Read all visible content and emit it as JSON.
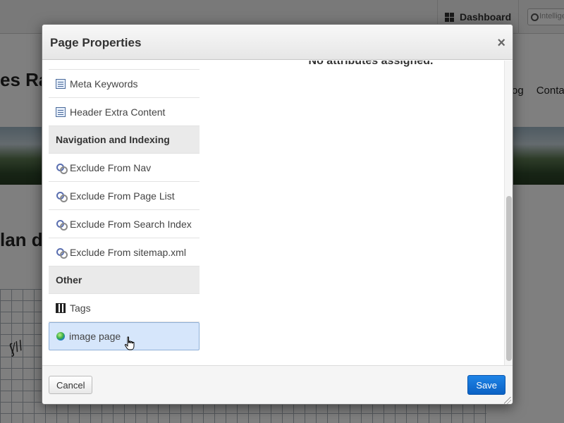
{
  "background": {
    "toolbar": {
      "dashboard_label": "Dashboard",
      "search_placeholder": "Intelligent"
    },
    "site_title": "es Ra",
    "nav": [
      "og",
      "Conta"
    ],
    "heading": "lan d"
  },
  "dialog": {
    "title": "Page Properties",
    "close_glyph": "×",
    "attribute_groups": [
      {
        "type": "item",
        "icon": "textarea-icon",
        "label": "Meta Keywords"
      },
      {
        "type": "item",
        "icon": "textarea-icon",
        "label": "Header Extra Content"
      },
      {
        "type": "category",
        "label": "Navigation and Indexing"
      },
      {
        "type": "item",
        "icon": "boolean-icon",
        "label": "Exclude From Nav"
      },
      {
        "type": "item",
        "icon": "boolean-icon",
        "label": "Exclude From Page List"
      },
      {
        "type": "item",
        "icon": "boolean-icon",
        "label": "Exclude From Search Index"
      },
      {
        "type": "item",
        "icon": "boolean-icon",
        "label": "Exclude From sitemap.xml"
      },
      {
        "type": "category",
        "label": "Other"
      },
      {
        "type": "item",
        "icon": "tags-icon",
        "label": "Tags"
      },
      {
        "type": "item",
        "icon": "image-icon",
        "label": "image page",
        "selected": true
      }
    ],
    "content_message": "No attributes assigned.",
    "footer": {
      "cancel_label": "Cancel",
      "save_label": "Save"
    }
  },
  "colors": {
    "save_button": "#1170d6",
    "selected_row": "#d6e6fb",
    "category_bg": "#eaeaea"
  }
}
